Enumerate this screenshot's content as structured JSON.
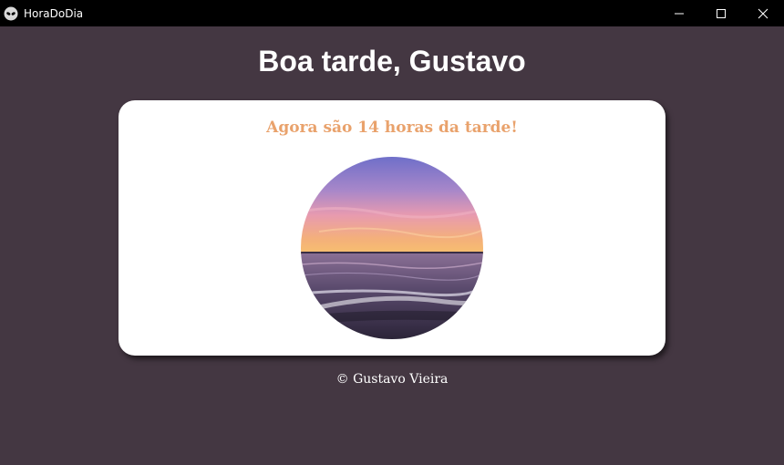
{
  "window": {
    "title": "HoraDoDia",
    "app_icon": "alien-icon",
    "controls": [
      "minimize-icon",
      "maximize-icon",
      "close-icon"
    ]
  },
  "greeting": "Boa tarde, Gustavo",
  "card": {
    "message": "Agora são 14 horas da tarde!",
    "image": "sunset-beach-image"
  },
  "footer": "© Gustavo Vieira",
  "colors": {
    "background": "#443742",
    "titlebar": "#000000",
    "card": "#ffffff",
    "accent": "#e9a26c"
  }
}
